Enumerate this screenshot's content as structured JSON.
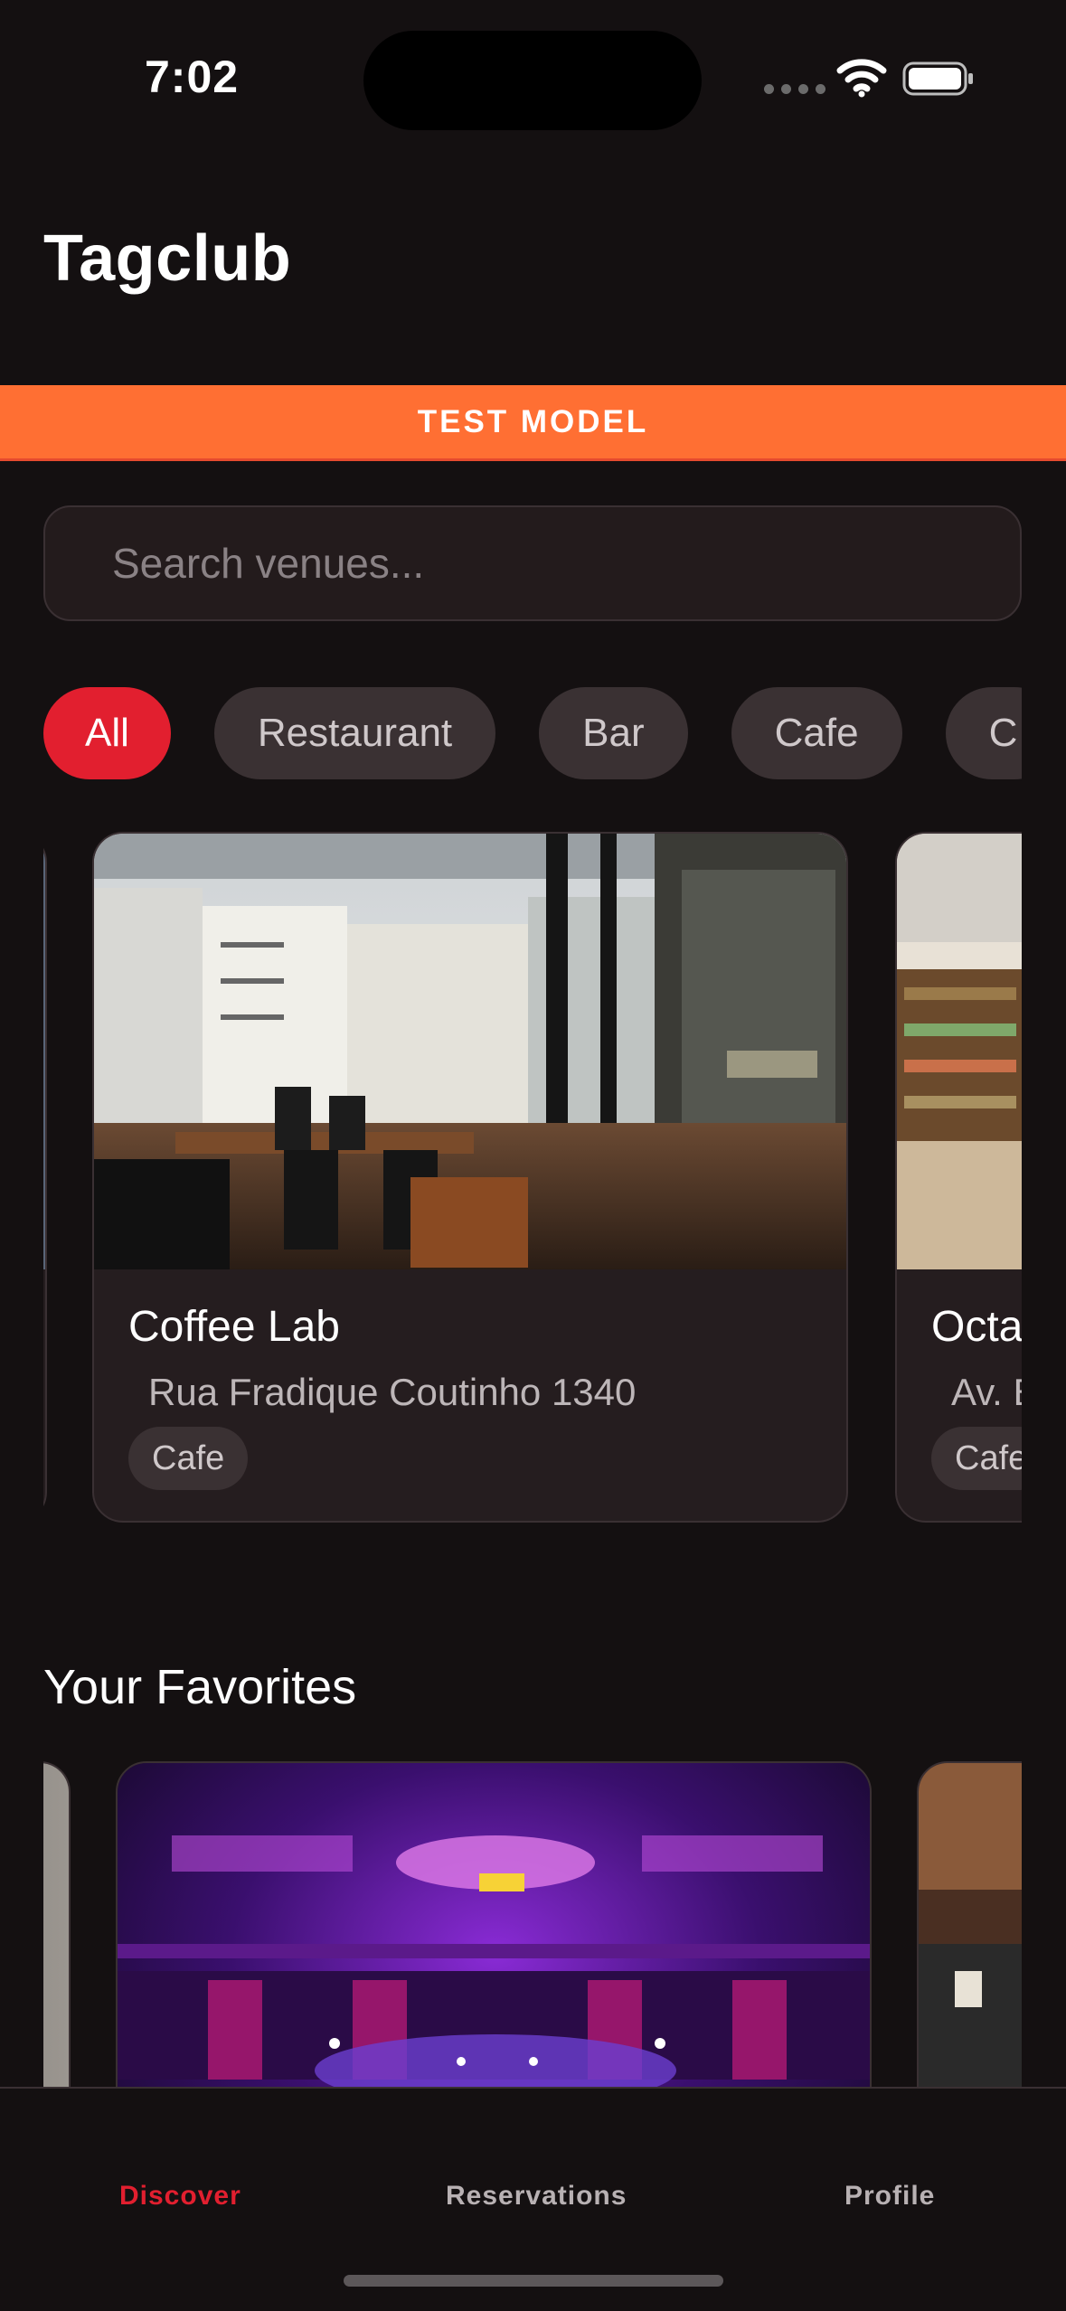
{
  "status_bar": {
    "time": "7:02"
  },
  "header": {
    "title": "Tagclub",
    "banner": "TEST MODEL"
  },
  "search": {
    "placeholder": "Search venues..."
  },
  "categories": {
    "selected": "All",
    "items": [
      "All",
      "Restaurant",
      "Bar",
      "Cafe",
      "C"
    ]
  },
  "venues": [
    {
      "name": "Coffee Lab",
      "address": "Rua Fradique Coutinho 1340",
      "category": "Cafe"
    },
    {
      "name": "Octa",
      "address": "Av. E",
      "category": "Cafe"
    }
  ],
  "favorites": {
    "title": "Your Favorites"
  },
  "tabs": [
    {
      "label": "Discover",
      "active": true
    },
    {
      "label": "Reservations",
      "active": false
    },
    {
      "label": "Profile",
      "active": false
    }
  ],
  "colors": {
    "accent": "#e21f2f",
    "banner": "#ff6f33",
    "background": "#141011",
    "card": "#251d1f"
  }
}
